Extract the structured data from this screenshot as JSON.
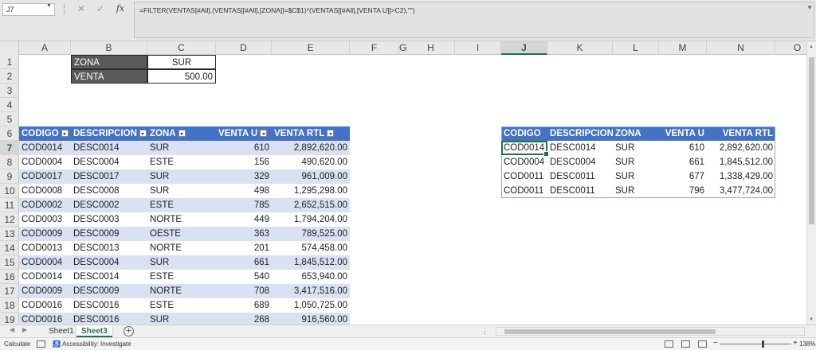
{
  "formula_bar": {
    "name_box": "J7",
    "cancel": "✕",
    "enter": "✓",
    "fx": "fx",
    "formula": "=FILTER(VENTAS[#All],(VENTAS[[#All],[ZONA]]=$C$1)*(VENTAS[[#All],[VENTA U]]>C2),\"\")"
  },
  "columns": [
    "A",
    "B",
    "C",
    "D",
    "E",
    "F",
    "G",
    "H",
    "I",
    "J",
    "K",
    "L",
    "M",
    "N",
    "O"
  ],
  "selected_column": "J",
  "rows": [
    "1",
    "2",
    "3",
    "4",
    "5",
    "6",
    "7",
    "8",
    "9",
    "10",
    "11",
    "12",
    "13",
    "14",
    "15",
    "16",
    "17",
    "18",
    "19"
  ],
  "selected_row": "7",
  "params": {
    "zona_label": "ZONA",
    "zona_value": "SUR",
    "venta_label": "VENTA",
    "venta_value": "500.00"
  },
  "ventas_table": {
    "headers": [
      "CODIGO",
      "DESCRIPCION",
      "ZONA",
      "VENTA U",
      "VENTA RTL"
    ],
    "rows": [
      [
        "COD0014",
        "DESC0014",
        "SUR",
        "610",
        "2,892,620.00"
      ],
      [
        "COD0004",
        "DESC0004",
        "ESTE",
        "156",
        "490,620.00"
      ],
      [
        "COD0017",
        "DESC0017",
        "SUR",
        "329",
        "961,009.00"
      ],
      [
        "COD0008",
        "DESC0008",
        "SUR",
        "498",
        "1,295,298.00"
      ],
      [
        "COD0002",
        "DESC0002",
        "ESTE",
        "785",
        "2,652,515.00"
      ],
      [
        "COD0003",
        "DESC0003",
        "NORTE",
        "449",
        "1,794,204.00"
      ],
      [
        "COD0009",
        "DESC0009",
        "OESTE",
        "363",
        "789,525.00"
      ],
      [
        "COD0013",
        "DESC0013",
        "NORTE",
        "201",
        "574,458.00"
      ],
      [
        "COD0004",
        "DESC0004",
        "SUR",
        "661",
        "1,845,512.00"
      ],
      [
        "COD0014",
        "DESC0014",
        "ESTE",
        "540",
        "653,940.00"
      ],
      [
        "COD0009",
        "DESC0009",
        "NORTE",
        "708",
        "3,417,516.00"
      ],
      [
        "COD0016",
        "DESC0016",
        "ESTE",
        "689",
        "1,050,725.00"
      ],
      [
        "COD0016",
        "DESC0016",
        "SUR",
        "268",
        "916,560.00"
      ]
    ]
  },
  "result_table": {
    "headers": [
      "CODIGO",
      "DESCRIPCION",
      "ZONA",
      "VENTA U",
      "VENTA RTL"
    ],
    "rows": [
      [
        "COD0014",
        "DESC0014",
        "SUR",
        "610",
        "2,892,620.00"
      ],
      [
        "COD0004",
        "DESC0004",
        "SUR",
        "661",
        "1,845,512.00"
      ],
      [
        "COD0011",
        "DESC0011",
        "SUR",
        "677",
        "1,338,429.00"
      ],
      [
        "COD0011",
        "DESC0011",
        "SUR",
        "796",
        "3,477,724.00"
      ]
    ]
  },
  "sheet_tabs": {
    "tabs": [
      "Sheet1",
      "Sheet3"
    ],
    "active": "Sheet3",
    "add": "+",
    "more": "⋮"
  },
  "status_bar": {
    "mode": "Calculate",
    "accessibility": "Accessibility: Investigate",
    "zoom": "138%",
    "zoom_minus": "−",
    "zoom_plus": "+"
  },
  "colors": {
    "header_blue": "#4472c4",
    "band_blue": "#d9e1f2",
    "excel_green": "#217346",
    "param_gray": "#595959"
  }
}
